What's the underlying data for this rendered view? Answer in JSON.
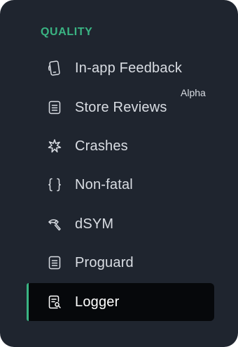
{
  "section": {
    "heading": "QUALITY"
  },
  "colors": {
    "accent": "#3ab483",
    "panel_bg": "#1f252f",
    "active_bg": "#06080b",
    "text": "#d9dde3"
  },
  "nav": {
    "items": [
      {
        "label": "In-app Feedback",
        "icon": "phone-icon",
        "active": false
      },
      {
        "label": "Store Reviews",
        "icon": "document-icon",
        "badge": "Alpha",
        "active": false
      },
      {
        "label": "Crashes",
        "icon": "burst-icon",
        "active": false
      },
      {
        "label": "Non-fatal",
        "icon": "braces-icon",
        "active": false
      },
      {
        "label": "dSYM",
        "icon": "hammer-icon",
        "active": false
      },
      {
        "label": "Proguard",
        "icon": "document-icon",
        "active": false
      },
      {
        "label": "Logger",
        "icon": "logger-icon",
        "active": true
      }
    ]
  }
}
